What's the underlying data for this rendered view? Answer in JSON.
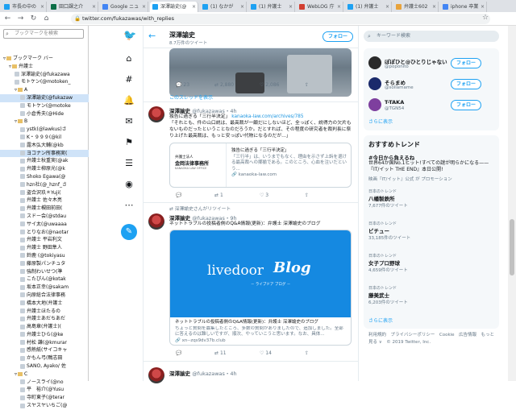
{
  "tabs": [
    {
      "label": "市長の中の",
      "color": "#1da1f2"
    },
    {
      "label": "田口課之介",
      "color": "#0d6e47"
    },
    {
      "label": "Google ニュ",
      "color": "#4285f4"
    },
    {
      "label": "深澤諭史(@",
      "color": "#1da1f2"
    },
    {
      "label": "(1) なかが",
      "color": "#1da1f2"
    },
    {
      "label": "(1) 弁護士",
      "color": "#1da1f2"
    },
    {
      "label": "WebLOG 庁",
      "color": "#d23f31"
    },
    {
      "label": "(1) 弁護士",
      "color": "#1da1f2"
    },
    {
      "label": "弁護士602",
      "color": "#e8a33c"
    },
    {
      "label": "iphone 卒業",
      "color": "#4285f4"
    }
  ],
  "address": {
    "url": "twitter.com/fukazawas/with_replies"
  },
  "sidebar": {
    "search_placeholder": "ブックマークを検索",
    "items": [
      {
        "label": "ブックマーク バー",
        "type": "folder",
        "indent": 0
      },
      {
        "label": "弁護士",
        "type": "folder",
        "indent": 1
      },
      {
        "label": "深澤諭史(@fukazawa",
        "type": "tw",
        "indent": 2
      },
      {
        "label": "モトケン(@motoken_",
        "type": "tw",
        "indent": 2
      },
      {
        "label": "A",
        "type": "folder",
        "indent": 2
      },
      {
        "label": "深澤諭史(@fukazaw",
        "type": "tw",
        "indent": 3,
        "selected": true
      },
      {
        "label": "モトケン(@motoke",
        "type": "tw",
        "indent": 3
      },
      {
        "label": "小倉秀夫(@Hide",
        "type": "tw",
        "indent": 3
      },
      {
        "label": "B",
        "type": "folder",
        "indent": 2
      },
      {
        "label": "ystk(@lawkus)さ",
        "type": "tw",
        "indent": 3
      },
      {
        "label": "K・９９９(@kil",
        "type": "tw",
        "indent": 3
      },
      {
        "label": "露木弘大輔(@kb",
        "type": "tw",
        "indent": 3
      },
      {
        "label": "ヨコナン所事務実(",
        "type": "tw",
        "indent": 3,
        "selected": true
      },
      {
        "label": "弁護士秋重実(@ak",
        "type": "tw",
        "indent": 3
      },
      {
        "label": "弁護士柳原光(@k",
        "type": "tw",
        "indent": 3
      },
      {
        "label": "Shoko Egawa(@",
        "type": "tw",
        "indent": 3
      },
      {
        "label": "hzn社(@_hznf_さ",
        "type": "tw",
        "indent": 3
      },
      {
        "label": "盗合沢玖＊Yuji(",
        "type": "tw",
        "indent": 3
      },
      {
        "label": "弁護士 佐々木亮",
        "type": "tw",
        "indent": 3
      },
      {
        "label": "弁護士槻田前田(",
        "type": "tw",
        "indent": 3
      },
      {
        "label": "スドー会(@stdau",
        "type": "tw",
        "indent": 3
      },
      {
        "label": "サイ太(@uwaaaa",
        "type": "tw",
        "indent": 3
      },
      {
        "label": "とりなお(@naotar",
        "type": "tw",
        "indent": 3
      },
      {
        "label": "弁護士 平岩利文",
        "type": "tw",
        "indent": 3
      },
      {
        "label": "弁護士 野田隼人",
        "type": "tw",
        "indent": 3
      },
      {
        "label": "鈴鹿 (@tokiyasu",
        "type": "tw",
        "indent": 3
      },
      {
        "label": "藤原製パンチュタ",
        "type": "tw",
        "indent": 3
      },
      {
        "label": "強制わいせつ(準",
        "type": "tw",
        "indent": 3
      },
      {
        "label": "こたぴん(@kotak",
        "type": "tw",
        "indent": 3
      },
      {
        "label": "坂本正幸(@sakam",
        "type": "tw",
        "indent": 3
      },
      {
        "label": "向原総合法律事務",
        "type": "tw",
        "indent": 3
      },
      {
        "label": "橋本大地(弁護士",
        "type": "tw",
        "indent": 3
      },
      {
        "label": "弁護士ほたるの",
        "type": "tw",
        "indent": 3
      },
      {
        "label": "弁護士あだちあだ",
        "type": "tw",
        "indent": 3
      },
      {
        "label": "高島章(弁護士)(",
        "type": "tw",
        "indent": 3
      },
      {
        "label": "弁護士ひら(@ke",
        "type": "tw",
        "indent": 3
      },
      {
        "label": "村松 謙(@kmurar",
        "type": "tw",
        "indent": 3
      },
      {
        "label": "感熱紙(サイコキャ",
        "type": "tw",
        "indent": 3
      },
      {
        "label": "かもん弓(鴨志田",
        "type": "tw",
        "indent": 3
      },
      {
        "label": "SANO, Ayako/ 佐",
        "type": "tw",
        "indent": 3
      },
      {
        "label": "C",
        "type": "folder",
        "indent": 2
      },
      {
        "label": "ノースライ(@no",
        "type": "tw",
        "indent": 3
      },
      {
        "label": "平　裕介(@Yusu",
        "type": "tw",
        "indent": 3
      },
      {
        "label": "寺町東子(@terar",
        "type": "tw",
        "indent": 3
      },
      {
        "label": "スヤスヤいちご(@",
        "type": "tw",
        "indent": 3
      }
    ]
  },
  "header": {
    "name": "深澤諭史",
    "count": "8.7万件のツイート",
    "follow": "フォロー"
  },
  "tweet0": {
    "reply": "23",
    "retweet": "2,880",
    "like": "2,086"
  },
  "show_thread": "このスレッドを表示",
  "tweet1": {
    "name": "深澤諭史",
    "handle": "@fukazawas・4h",
    "text1": "独告に過ぎる「三行半決定」",
    "link": "kanaoka-law.com/archives/785",
    "text2": "「それとも、件の山口説は、最高裁が一顧だにしないほど、全っぽく、説得力の欠片もないものだったということなのだろうか。だとすれば、その程度の研究者を裁判長に祭り上げた最高裁は、もっと安っぽい代物になるのだが…」",
    "card_logo1": "弁護士法人",
    "card_logo2": "金岡法律事務所",
    "card_logo3": "KANAOKA LAW OFFICE",
    "card_title": "独告に過ぎる「三行半決定」",
    "card_desc": "「三行半」は、いうまでもなく、理由を示さず上訴を退ける最高裁への揶揄である。このところ、心血を注いだという...",
    "card_domain": "kanaoka-law.com",
    "reply": "",
    "retweet": "1",
    "like": "3"
  },
  "rt_label": "深澤諭史さんがリツイート",
  "tweet2": {
    "name": "深澤諭史",
    "handle": "@fukazawas・9h",
    "text": "ネットトラブルの投稿者側のQ&A情報(更新)：弁護士 深澤諭史のブログ",
    "card_brand": "livedoor",
    "card_brand2": "Blog",
    "card_sub": "－ ライブドア ブログ －",
    "card_title": "ネットトラブルの投稿者側のQ&A情報(更新)：弁護士 深澤諭史のブログ",
    "card_desc": "ちょっと質問を募集したところ、多数の質問がありましたので、追加しました。全部に答えるのは難しいですが、順次、やっていこうと思います。なお、具体...",
    "card_domain": "xn--zqs9dv37b.club",
    "reply": "",
    "retweet": "11",
    "like": "14"
  },
  "tweet3": {
    "name": "深澤諭史",
    "handle": "@fukazawas・4h"
  },
  "right": {
    "search_placeholder": "キーワード検索",
    "suggest": [
      {
        "name": "ぽぽひと@ひとりじゃない",
        "handle": "@poponito",
        "btn": "フォロー",
        "color": "#2a2a2a"
      },
      {
        "name": "そらまめ",
        "handle": "@sollamame",
        "btn": "フォロー",
        "color": "#1b2a6b"
      },
      {
        "name": "T-TAKA",
        "handle": "@TGN54",
        "btn": "フォロー",
        "color": "#7e3f9e"
      }
    ],
    "suggest_more": "さらに表示",
    "trends_title": "おすすめトレンド",
    "trends": [
      {
        "label": "",
        "name": "#今日から負えるね",
        "desc": "世界64か国No.1ヒット!すべての謎が明らかになる——『IT/イット THE END』本日公開!",
        "promo": "映画『IT/イット』公式 が プロモーション"
      },
      {
        "label": "日本のトレンド",
        "name": "八幡製鉄所",
        "count": "7,677件のツイート"
      },
      {
        "label": "日本のトレンド",
        "name": "ビチュー",
        "count": "33,185件のツイート"
      },
      {
        "label": "日本のトレンド",
        "name": "女子プロ野球",
        "count": "4,659件のツイート"
      },
      {
        "label": "日本のトレンド",
        "name": "藤美武士",
        "count": "6,203件のツイート"
      }
    ],
    "trends_more": "さらに表示",
    "footer": "利用規約　プライバシーポリシー　Cookie　広告情報　もっと見る ∨　© 2019 Twitter, Inc."
  }
}
